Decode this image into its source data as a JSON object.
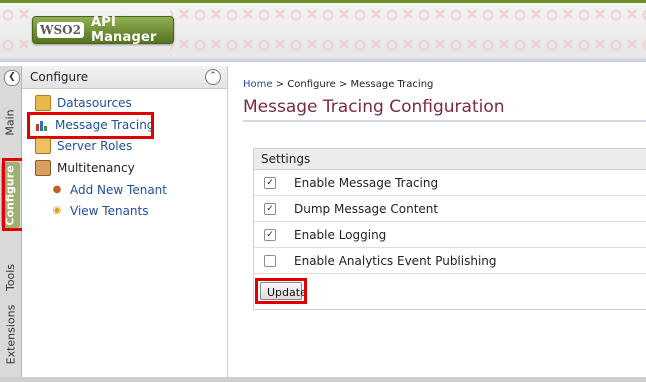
{
  "header": {
    "logo_wso2": "WSO2",
    "logo_text": "API Manager"
  },
  "tabs": [
    {
      "label": "Main",
      "active": false
    },
    {
      "label": "Configure",
      "active": true
    },
    {
      "label": "Tools",
      "active": false
    },
    {
      "label": "Extensions",
      "active": false
    }
  ],
  "nav": {
    "title": "Configure",
    "items": [
      {
        "label": "Datasources",
        "icon": "datasources-icon"
      },
      {
        "label": "Message Tracing",
        "icon": "bar-chart-icon"
      },
      {
        "label": "Server Roles",
        "icon": "server-roles-icon"
      },
      {
        "label": "Multitenancy",
        "icon": "multitenancy-icon"
      },
      {
        "label": "Add New Tenant",
        "icon": "add-tenant-icon"
      },
      {
        "label": "View Tenants",
        "icon": "view-tenants-icon"
      }
    ]
  },
  "breadcrumb": {
    "home": "Home",
    "sep": ">",
    "configure": "Configure",
    "current": "Message Tracing"
  },
  "page": {
    "title": "Message Tracing Configuration"
  },
  "settings": {
    "header": "Settings",
    "options": [
      {
        "label": "Enable Message Tracing",
        "checked": true
      },
      {
        "label": "Dump Message Content",
        "checked": true
      },
      {
        "label": "Enable Logging",
        "checked": true
      },
      {
        "label": "Enable Analytics Event Publishing",
        "checked": false
      }
    ],
    "update_label": "Update"
  },
  "colors": {
    "accent_green": "#6b8e23",
    "title_maroon": "#7a2c3c",
    "link_blue": "#1f4e9b",
    "highlight_red": "#e00000"
  }
}
